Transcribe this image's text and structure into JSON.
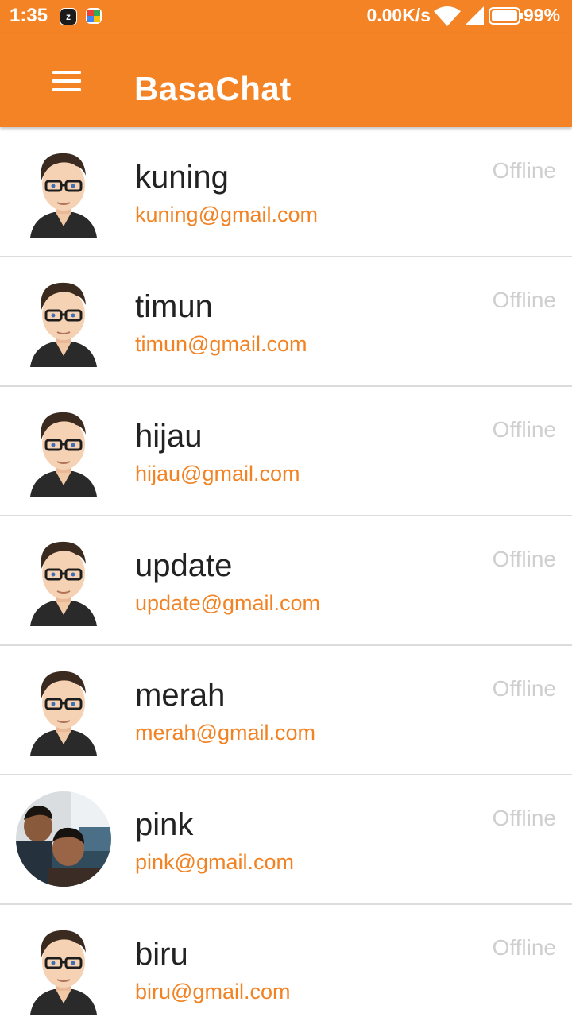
{
  "status_bar": {
    "time": "1:35",
    "network_speed": "0.00K/s",
    "battery_percent": "99%",
    "app_icons": [
      "z-app-icon",
      "colorful-app-icon"
    ],
    "icons": [
      "wifi-icon",
      "cell-signal-icon",
      "battery-icon"
    ]
  },
  "app_bar": {
    "title": "BasaChat",
    "menu_icon": "hamburger-menu-icon"
  },
  "colors": {
    "primary": "#f48325",
    "email": "#f28324",
    "status": "#cfcfcf",
    "divider": "#dcdcdc"
  },
  "contacts": [
    {
      "name": "kuning",
      "email": "kuning@gmail.com",
      "status": "Offline",
      "avatar": "cartoon-man-avatar"
    },
    {
      "name": "timun",
      "email": "timun@gmail.com",
      "status": "Offline",
      "avatar": "cartoon-man-avatar"
    },
    {
      "name": "hijau",
      "email": "hijau@gmail.com",
      "status": "Offline",
      "avatar": "cartoon-man-avatar"
    },
    {
      "name": "update",
      "email": "update@gmail.com",
      "status": "Offline",
      "avatar": "cartoon-man-avatar"
    },
    {
      "name": "merah",
      "email": "merah@gmail.com",
      "status": "Offline",
      "avatar": "cartoon-man-avatar"
    },
    {
      "name": "pink",
      "email": "pink@gmail.com",
      "status": "Offline",
      "avatar": "photo-avatar"
    },
    {
      "name": "biru",
      "email": "biru@gmail.com",
      "status": "Offline",
      "avatar": "cartoon-man-avatar"
    }
  ]
}
